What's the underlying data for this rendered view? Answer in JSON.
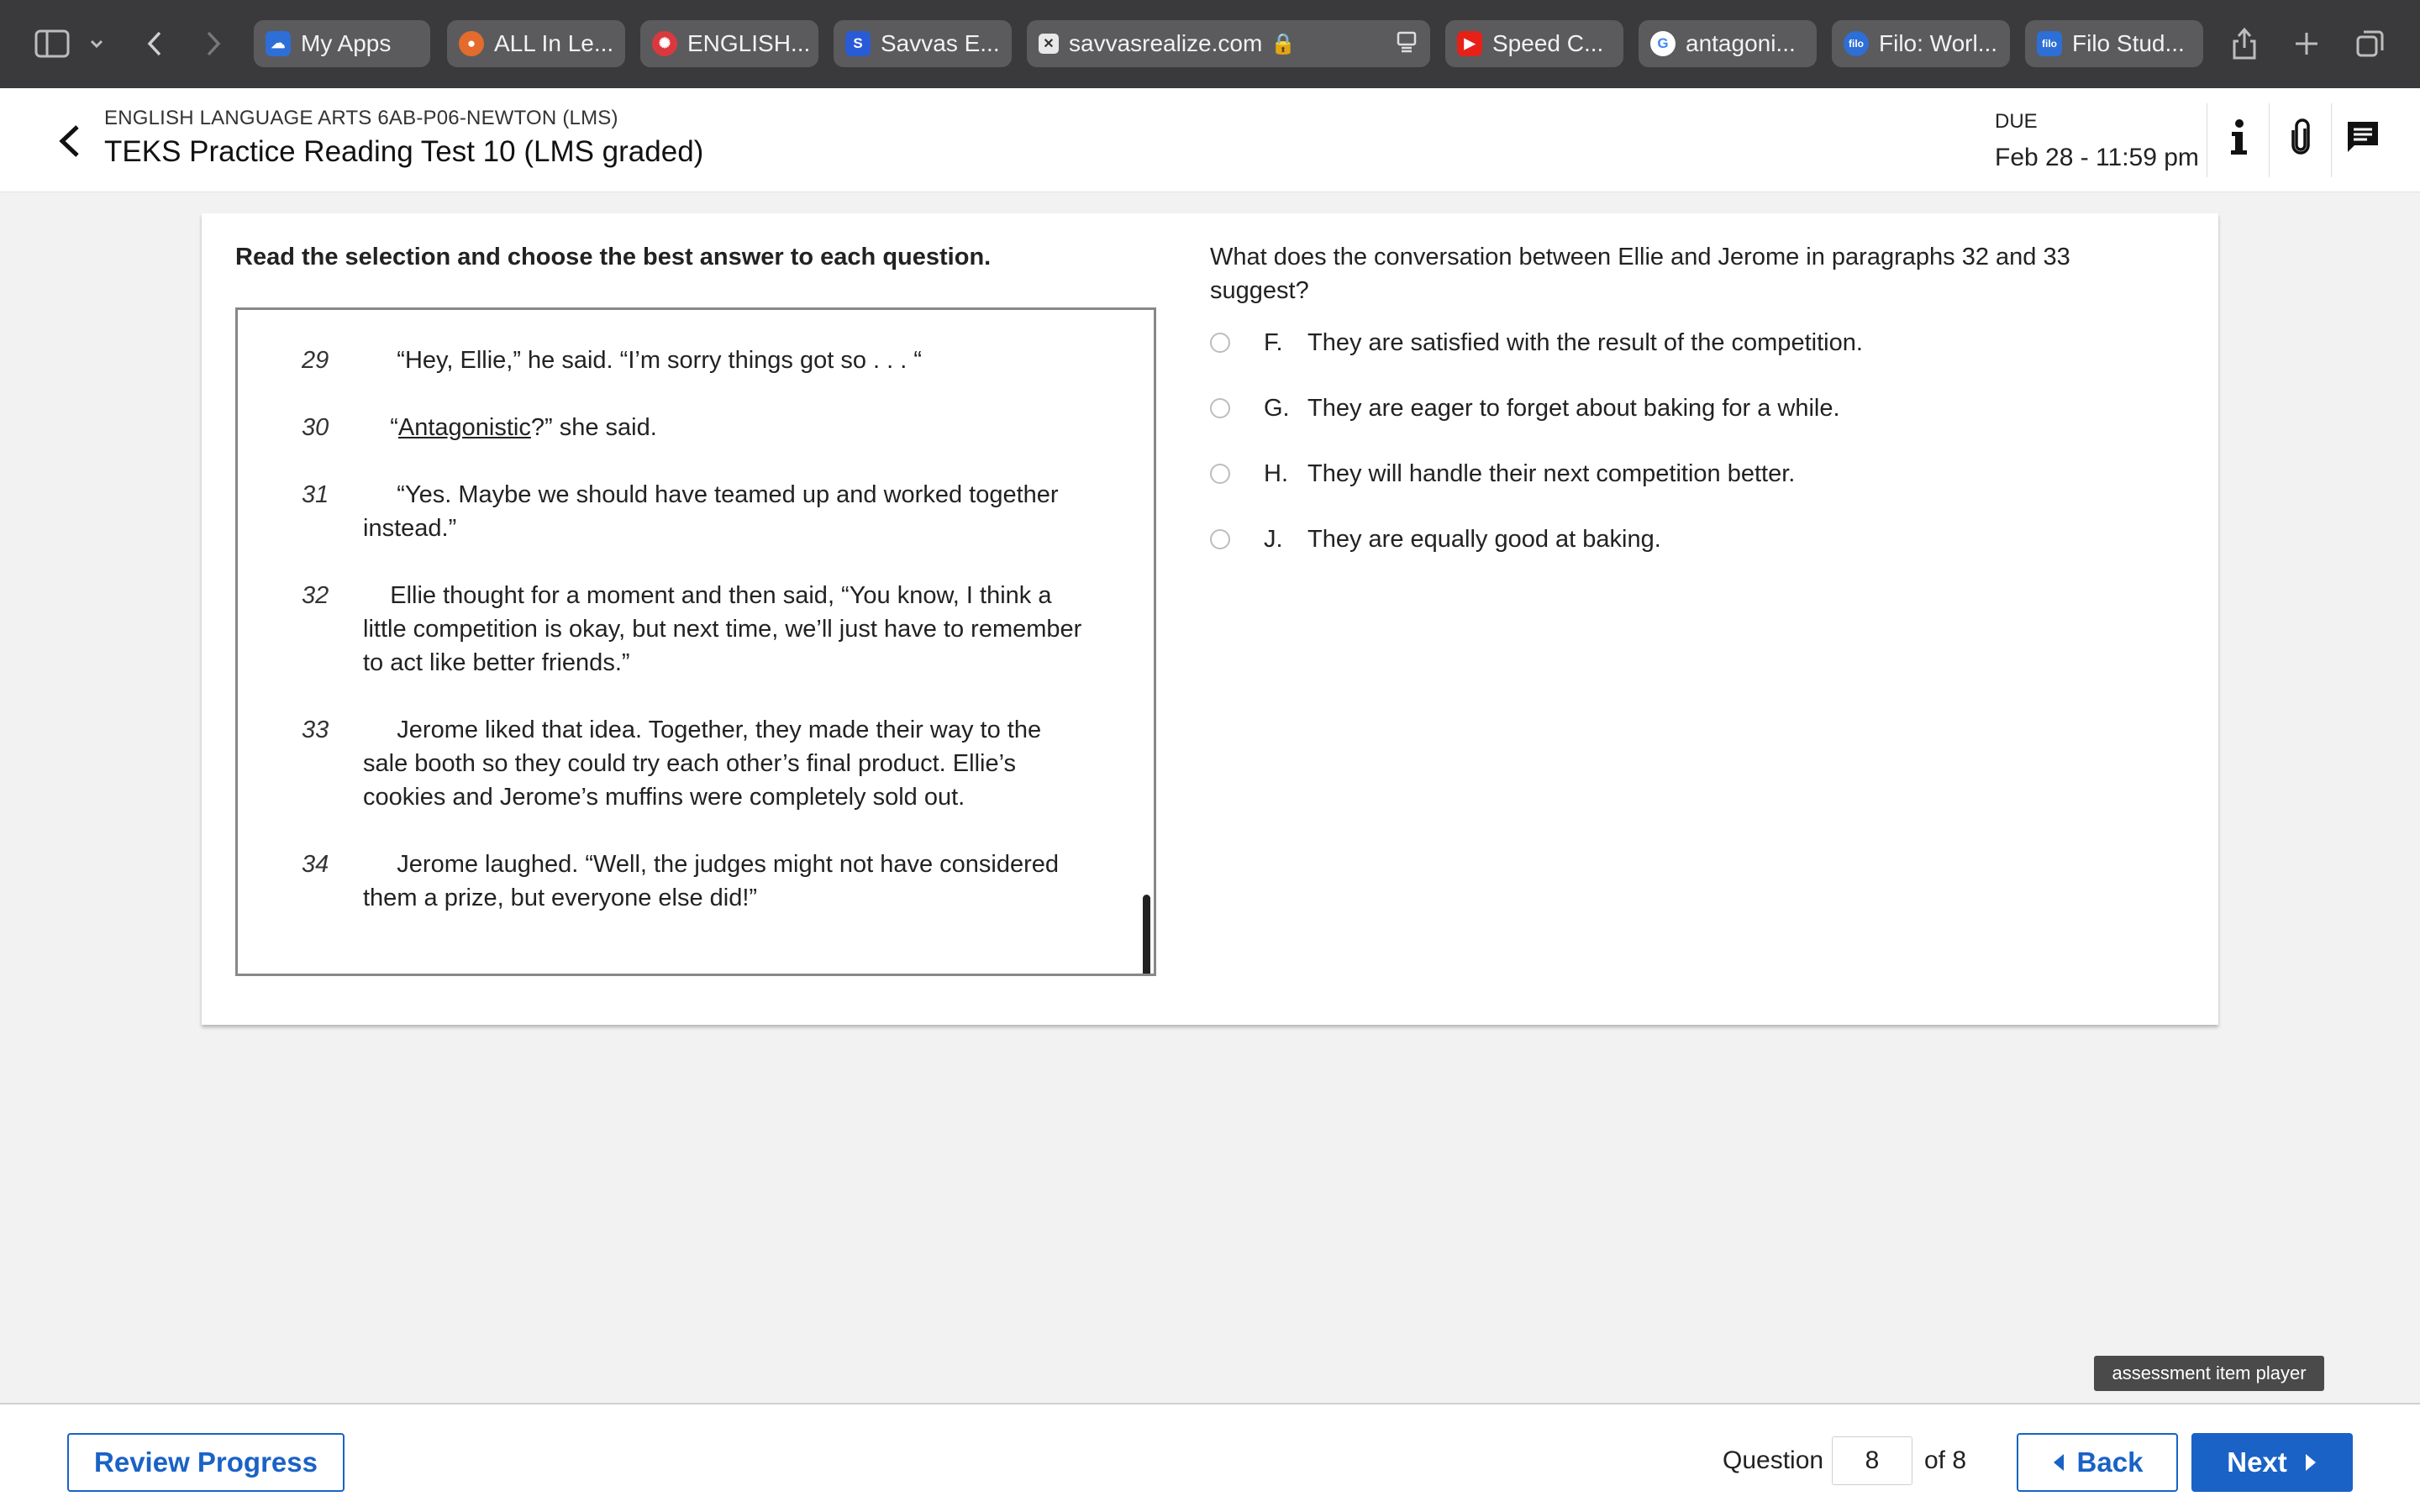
{
  "browser": {
    "tabs": [
      {
        "label": "My Apps",
        "icon": "cloud-icon",
        "color": "#2d6fd6"
      },
      {
        "label": "ALL In Le...",
        "icon": "globe-icon",
        "color": "#e46b2c"
      },
      {
        "label": "ENGLISH...",
        "icon": "gear-icon",
        "color": "#d9393e"
      },
      {
        "label": "Savvas E...",
        "icon": "savvas-icon",
        "color": "#2a5bd7"
      },
      {
        "label": "savvasrealize.com",
        "icon": "close-icon",
        "color": "#ffffff"
      },
      {
        "label": "Speed C...",
        "icon": "youtube-icon",
        "color": "#e62117"
      },
      {
        "label": "antagoni...",
        "icon": "google-icon",
        "color": "#ffffff"
      },
      {
        "label": "Filo: Worl...",
        "icon": "filo-icon",
        "color": "#2d6fd6"
      },
      {
        "label": "Filo Stud...",
        "icon": "filo-icon",
        "color": "#2d6fd6"
      }
    ]
  },
  "header": {
    "course": "ENGLISH LANGUAGE ARTS 6AB-P06-NEWTON (LMS)",
    "title": "TEKS Practice Reading Test 10 (LMS graded)",
    "due_label": "DUE",
    "due_value": "Feb 28 - 11:59 pm"
  },
  "main": {
    "instructions": "Read the selection and choose the best answer to each question.",
    "paragraphs": [
      {
        "num": "29",
        "text": "     “Hey, Ellie,” he said. “I’m sorry things got so . . . “"
      },
      {
        "num": "30",
        "pre": "    “",
        "link": "Antagonistic",
        "post": "?” she said."
      },
      {
        "num": "31",
        "text": "     “Yes. Maybe we should have teamed up and worked together instead.”"
      },
      {
        "num": "32",
        "text": "    Ellie thought for a moment and then said, “You know, I think a little competition is okay, but next time, we’ll just have to remember to act like better friends.”"
      },
      {
        "num": "33",
        "text": "     Jerome liked that idea. Together, they made their way to the sale booth so they could try each other’s final product. Ellie’s cookies and Jerome’s muffins were completely sold out."
      },
      {
        "num": "34",
        "text": "     Jerome laughed. “Well, the judges might not have considered them a prize, but everyone else did!”"
      }
    ],
    "question": "What does the conversation between Ellie and Jerome in paragraphs 32 and 33 suggest?",
    "choices": [
      {
        "letter": "F.",
        "text": "They are satisfied with the result of the competition."
      },
      {
        "letter": "G.",
        "text": "They are eager to forget about baking for a while."
      },
      {
        "letter": "H.",
        "text": "They will handle their next competition better."
      },
      {
        "letter": "J.",
        "text": "They are equally good at baking."
      }
    ]
  },
  "footer": {
    "review_label": "Review Progress",
    "question_label": "Question",
    "question_number": "8",
    "of_label": "of 8",
    "back_label": "Back",
    "next_label": "Next",
    "tooltip": "assessment item player"
  },
  "colors": {
    "accent": "#1a62c6",
    "browser_bar": "#3a3a3c"
  }
}
